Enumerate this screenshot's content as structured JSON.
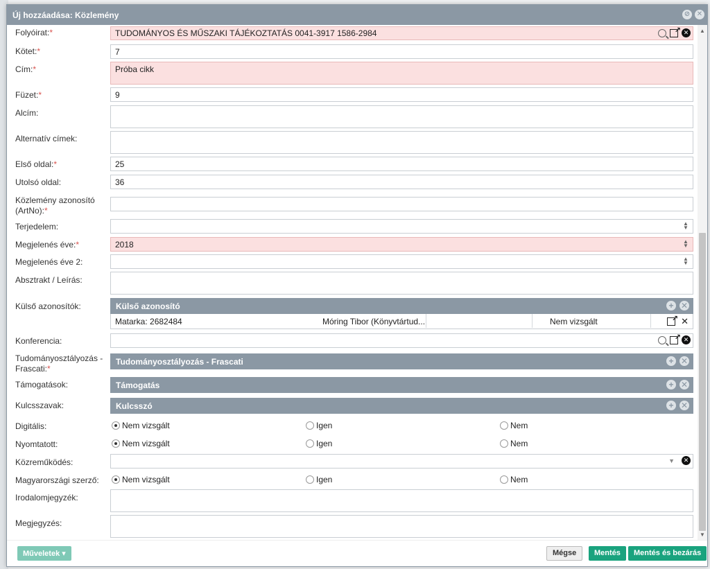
{
  "window": {
    "title": "Új hozzáadása: Közlemény"
  },
  "fields": {
    "journal": {
      "label": "Folyóirat:",
      "value": "TUDOMÁNYOS ÉS MŰSZAKI TÁJÉKOZTATÁS 0041-3917 1586-2984"
    },
    "volume": {
      "label": "Kötet:",
      "value": "7"
    },
    "title": {
      "label": "Cím:",
      "value": "Próba cikk"
    },
    "issue": {
      "label": "Füzet:",
      "value": "9"
    },
    "subtitle": {
      "label": "Alcím:",
      "value": ""
    },
    "alt_titles": {
      "label": "Alternatív címek:",
      "value": ""
    },
    "first_page": {
      "label": "Első oldal:",
      "value": "25"
    },
    "last_page": {
      "label": "Utolsó oldal:",
      "value": "36"
    },
    "artno": {
      "label_line1": "Közlemény azonosító",
      "label_line2": "(ArtNo):",
      "value": ""
    },
    "extent": {
      "label": "Terjedelem:",
      "value": ""
    },
    "pub_year": {
      "label": "Megjelenés éve:",
      "value": "2018"
    },
    "pub_year2": {
      "label": "Megjelenés éve 2:",
      "value": ""
    },
    "abstract": {
      "label": "Absztrakt / Leírás:",
      "value": ""
    },
    "external_ids": {
      "label": "Külső azonosítók:",
      "header": "Külső azonosító",
      "row": {
        "source": "Matarka: 2682484",
        "author": "Móring Tibor (Könyvtártud...",
        "status": "Nem vizsgált"
      }
    },
    "conference": {
      "label": "Konferencia:",
      "value": ""
    },
    "frascati": {
      "label_line1": "Tudományosztályozás -",
      "label_line2": "Frascati:",
      "header": "Tudományosztályozás - Frascati"
    },
    "funding": {
      "label": "Támogatások:",
      "header": "Támogatás"
    },
    "keywords": {
      "label": "Kulcsszavak:",
      "header": "Kulcsszó"
    },
    "digital": {
      "label": "Digitális:",
      "options": [
        "Nem vizsgált",
        "Igen",
        "Nem"
      ],
      "selected": "Nem vizsgált"
    },
    "printed": {
      "label": "Nyomtatott:",
      "options": [
        "Nem vizsgált",
        "Igen",
        "Nem"
      ],
      "selected": "Nem vizsgált"
    },
    "contribution": {
      "label": "Közreműködés:",
      "value": ""
    },
    "hungarian_author": {
      "label": "Magyarországi szerző:",
      "options": [
        "Nem vizsgált",
        "Igen",
        "Nem"
      ],
      "selected": "Nem vizsgált"
    },
    "bibliography": {
      "label": "Irodalomjegyzék:",
      "value": ""
    },
    "note": {
      "label": "Megjegyzés:",
      "value": ""
    }
  },
  "required_mark": "*",
  "footer": {
    "operations": "Műveletek",
    "cancel": "Mégse",
    "save": "Mentés",
    "save_close": "Mentés és bezárás"
  }
}
